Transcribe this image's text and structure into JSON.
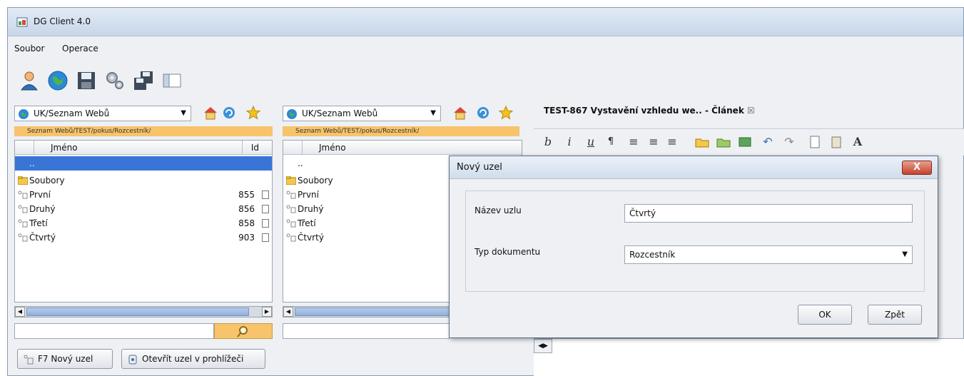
{
  "window": {
    "title": "DG Client 4.0"
  },
  "menu": {
    "items": [
      "Soubor",
      "Operace"
    ]
  },
  "toolbar": {
    "icons": [
      "user-icon",
      "globe-icon",
      "save-icon",
      "settings-icon",
      "save-multiple-icon",
      "panel-icon"
    ]
  },
  "left_panel": {
    "combo": "UK/Seznam Webů",
    "path": "Seznam Webů/TEST/pokus/Rozcestník/",
    "col_name": "Jméno",
    "col_id": "Id",
    "rows": [
      {
        "name": "..",
        "id": ""
      },
      {
        "name": "Soubory",
        "id": ""
      },
      {
        "name": "První",
        "id": "855"
      },
      {
        "name": "Druhý",
        "id": "856"
      },
      {
        "name": "Třetí",
        "id": "858"
      },
      {
        "name": "Čtvrtý",
        "id": "903"
      }
    ]
  },
  "middle_panel": {
    "combo": "UK/Seznam Webů",
    "path": "Seznam Webů/TEST/pokus/Rozcestník/",
    "col_name": "Jméno",
    "rows": [
      {
        "name": ".."
      },
      {
        "name": "Soubory"
      },
      {
        "name": "První"
      },
      {
        "name": "Druhý"
      },
      {
        "name": "Třetí"
      },
      {
        "name": "Čtvrtý"
      }
    ]
  },
  "bottom_buttons": {
    "new_node": "F7 Nový uzel",
    "open_in_browser": "Otevřít uzel v prohlížeči"
  },
  "editor": {
    "tab": "TEST-867 Vystavění vzhledu we.. - Článek",
    "format_buttons": [
      "b",
      "i",
      "u",
      "¶",
      "A"
    ]
  },
  "dialog": {
    "title": "Nový uzel",
    "name_label": "Název uzlu",
    "name_value": "Čtvrtý",
    "type_label": "Typ dokumentu",
    "type_value": "Rozcestník",
    "ok": "OK",
    "back": "Zpět",
    "close": "X"
  }
}
